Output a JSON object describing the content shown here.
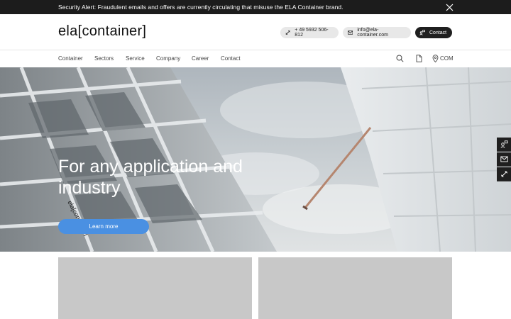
{
  "alert": {
    "text": "Security Alert: Fraudulent emails and offers are currently circulating that misuse the ELA Container brand.",
    "close_icon": "close-icon"
  },
  "header": {
    "logo": "ela[container]",
    "phone": {
      "label": "+ 49 5932 506-812",
      "icon": "phone-icon"
    },
    "email": {
      "label": "info@ela-container.com",
      "icon": "mail-icon"
    },
    "contact": {
      "label": "Contact",
      "icon": "chat-icon"
    }
  },
  "nav": {
    "items": [
      {
        "label": "Container"
      },
      {
        "label": "Sectors"
      },
      {
        "label": "Service"
      },
      {
        "label": "Company"
      },
      {
        "label": "Career"
      },
      {
        "label": "Contact"
      }
    ],
    "search_icon": "search-icon",
    "document_icon": "document-icon",
    "language": {
      "label": "COM",
      "icon": "location-pin-icon"
    }
  },
  "hero": {
    "title": "For any application and industry",
    "button": "Learn more",
    "container_stamp": "ela[container]"
  },
  "side_tabs": [
    {
      "icon": "chat-icon"
    },
    {
      "icon": "mail-icon"
    },
    {
      "icon": "phone-icon"
    }
  ],
  "colors": {
    "alert_bg": "#1c1c1c",
    "accent": "#4a90e2",
    "dark_button": "#1f1f1f",
    "card_placeholder": "#c8c8c8"
  }
}
